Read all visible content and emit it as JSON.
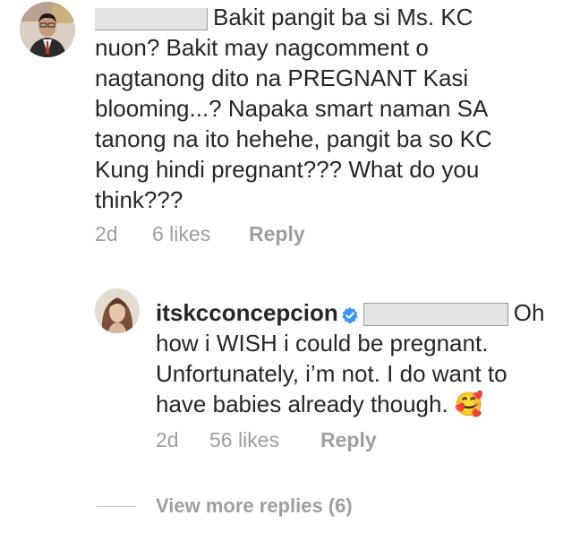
{
  "comment1": {
    "lines": [
      "Bakit pangit ba si Ms. KC",
      "nuon? Bakit may nagcomment o",
      "nagtanong dito na PREGNANT Kasi",
      "blooming...? Napaka smart naman SA",
      "tanong na ito hehehe, pangit ba so KC",
      "Kung hindi pregnant??? What do you",
      "think???"
    ],
    "time": "2d",
    "likes": "6 likes",
    "reply_label": "Reply"
  },
  "comment2": {
    "username": "itskcconcepcion",
    "lines": [
      "Oh",
      "how i WISH i could be pregnant.",
      "Unfortunately, i’m not. I do want to",
      "have babies already though. 🥰"
    ],
    "time": "2d",
    "likes": "56 likes",
    "reply_label": "Reply"
  },
  "view_more": "View more replies (6)",
  "colors": {
    "text": "#262626",
    "meta": "#9e9e9e",
    "verified": "#3897f0"
  }
}
